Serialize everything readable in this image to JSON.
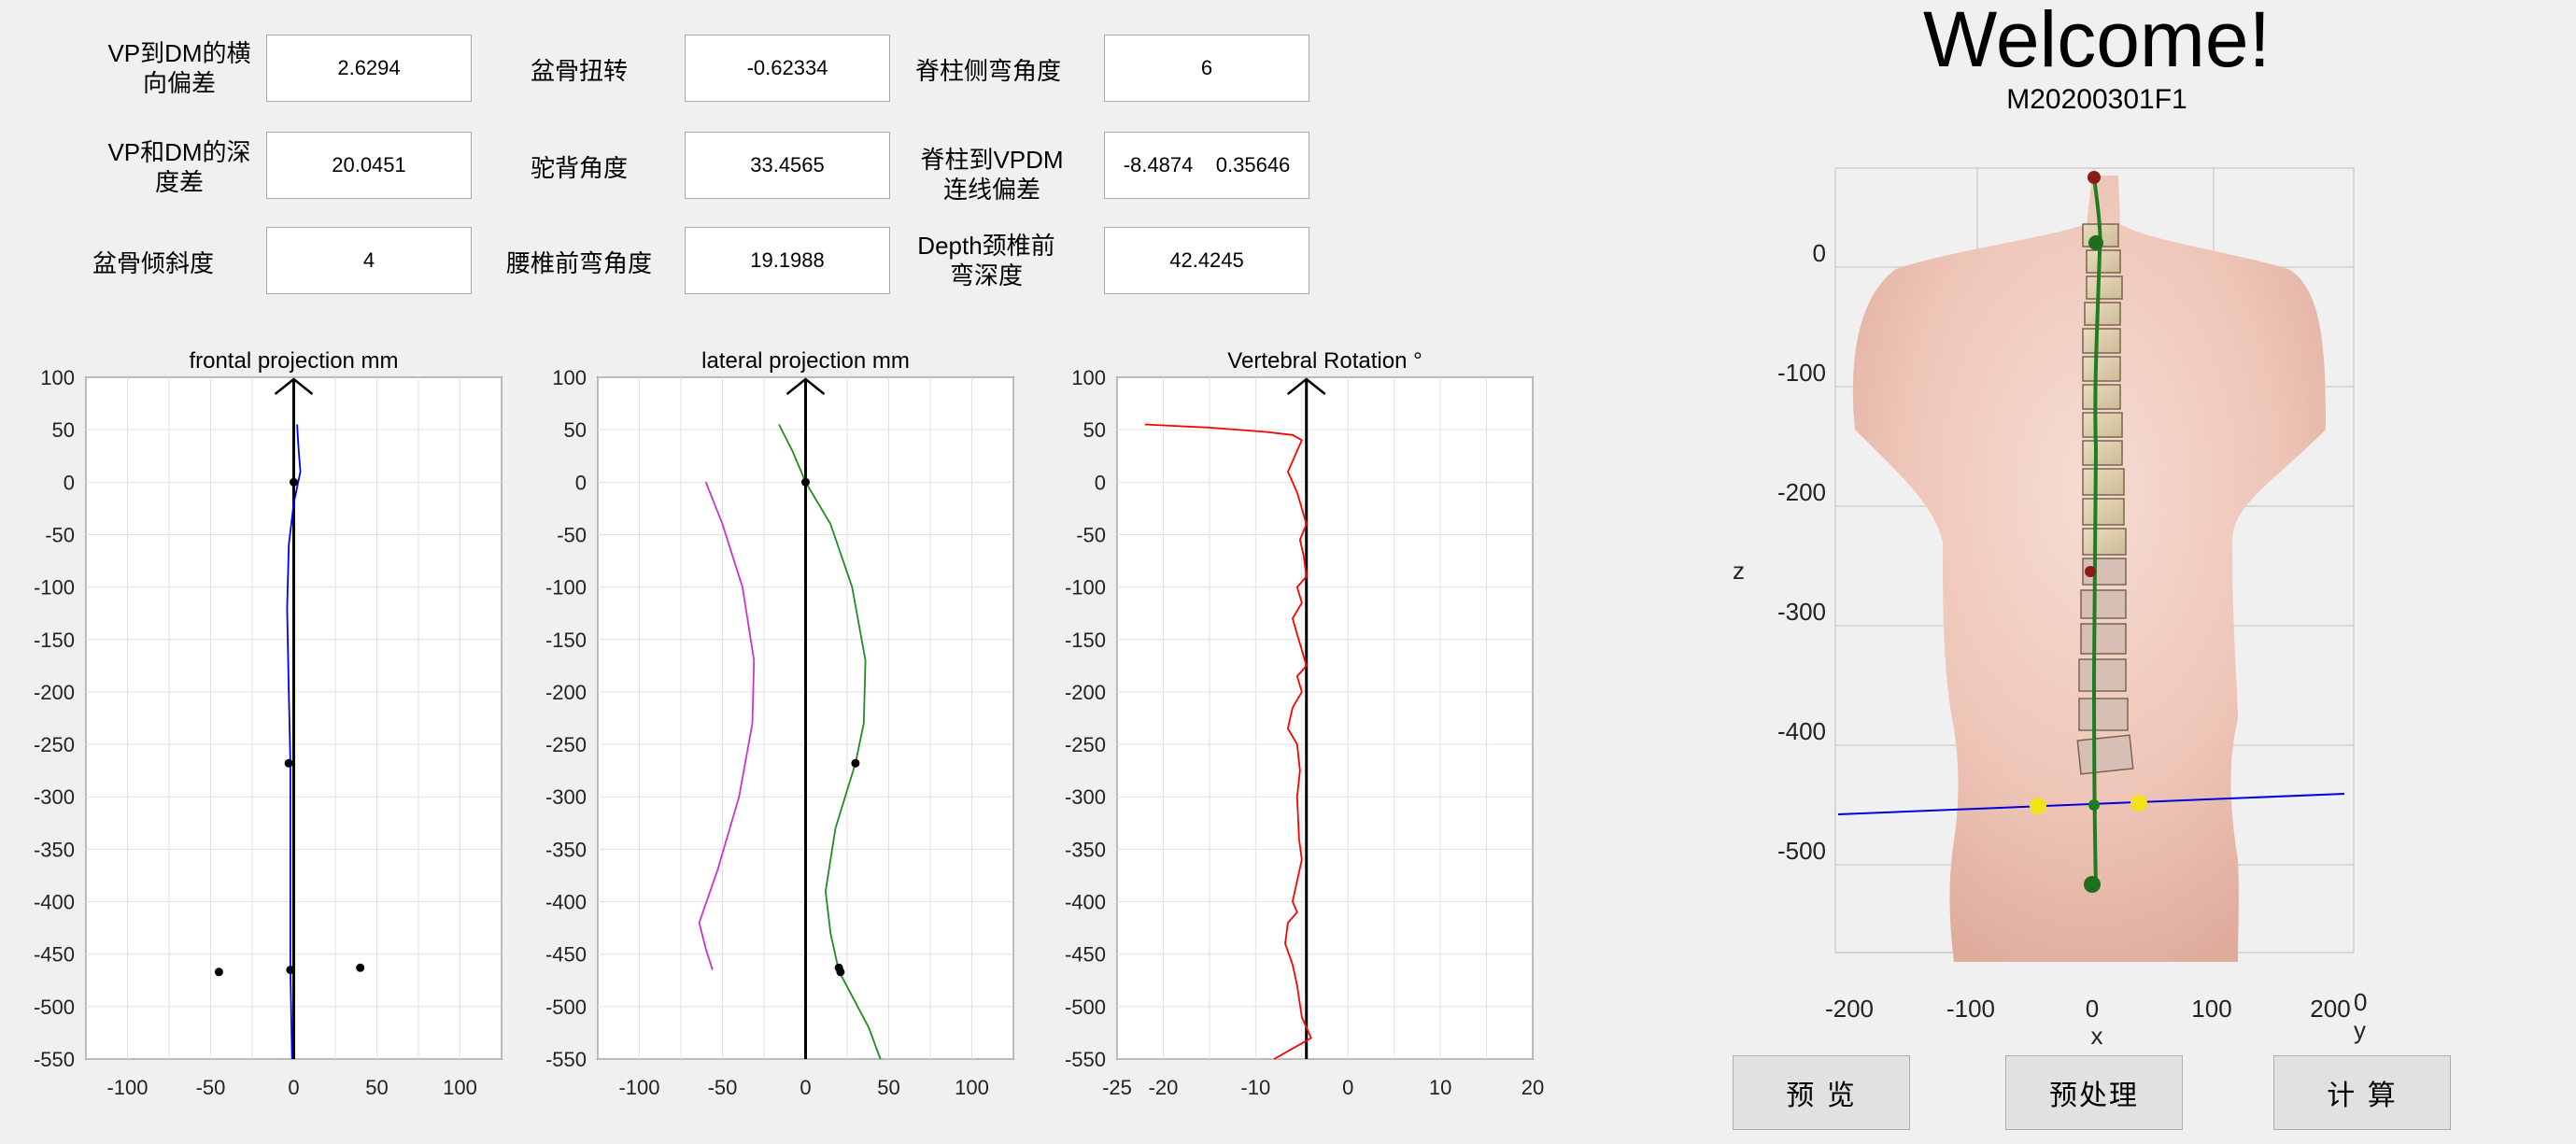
{
  "params": [
    {
      "label": "VP到DM的横\n向偏差",
      "value": "2.6294"
    },
    {
      "label": "盆骨扭转",
      "value": "-0.62334"
    },
    {
      "label": "脊柱侧弯角度",
      "value": "6"
    },
    {
      "label": "VP和DM的深\n度差",
      "value": "20.0451"
    },
    {
      "label": "驼背角度",
      "value": "33.4565"
    },
    {
      "label": "脊柱到VPDM\n连线偏差",
      "value": "-8.4874    0.35646"
    },
    {
      "label": "盆骨倾斜度",
      "value": "4"
    },
    {
      "label": "腰椎前弯角度",
      "value": "19.1988"
    },
    {
      "label": "Depth颈椎前\n弯深度",
      "value": "42.4245"
    }
  ],
  "chart_data": [
    {
      "type": "line",
      "title": "frontal projection mm",
      "xlim": [
        -125,
        125
      ],
      "ylim": [
        -550,
        100
      ],
      "xticks": [
        -100,
        -50,
        0,
        50,
        100
      ],
      "yticks": [
        100,
        50,
        0,
        -50,
        -100,
        -150,
        -200,
        -250,
        -300,
        -350,
        -400,
        -450,
        -500,
        -550
      ],
      "grid": true,
      "series": [
        {
          "color": "#0000ff",
          "points": [
            [
              2,
              55
            ],
            [
              3,
              30
            ],
            [
              4,
              10
            ],
            [
              0,
              -20
            ],
            [
              -3,
              -60
            ],
            [
              -4,
              -120
            ],
            [
              -3,
              -200
            ],
            [
              -2,
              -268
            ],
            [
              -2,
              -340
            ],
            [
              -2,
              -420
            ],
            [
              -2,
              -465
            ],
            [
              -1,
              -550
            ]
          ]
        }
      ],
      "axis_arrow_x": 0,
      "markers": [
        [
          0,
          0
        ],
        [
          -3,
          -268
        ],
        [
          -2,
          -465
        ],
        [
          -45,
          -467
        ],
        [
          40,
          -463
        ]
      ]
    },
    {
      "type": "line",
      "title": "lateral projection mm",
      "xlim": [
        -125,
        125
      ],
      "ylim": [
        -550,
        100
      ],
      "xticks": [
        -100,
        -50,
        0,
        50,
        100
      ],
      "yticks": [
        100,
        50,
        0,
        -50,
        -100,
        -150,
        -200,
        -250,
        -300,
        -350,
        -400,
        -450,
        -500,
        -550
      ],
      "grid": true,
      "series": [
        {
          "color": "#cc33cc",
          "points": [
            [
              -60,
              0
            ],
            [
              -50,
              -40
            ],
            [
              -38,
              -100
            ],
            [
              -31,
              -170
            ],
            [
              -32,
              -230
            ],
            [
              -40,
              -300
            ],
            [
              -53,
              -370
            ],
            [
              -64,
              -420
            ],
            [
              -60,
              -445
            ],
            [
              -56,
              -465
            ]
          ]
        },
        {
          "color": "#228b22",
          "points": [
            [
              -16,
              55
            ],
            [
              -8,
              30
            ],
            [
              0,
              0
            ],
            [
              15,
              -40
            ],
            [
              28,
              -100
            ],
            [
              36,
              -170
            ],
            [
              35,
              -230
            ],
            [
              30,
              -268
            ],
            [
              18,
              -330
            ],
            [
              12,
              -390
            ],
            [
              15,
              -430
            ],
            [
              20,
              -466
            ],
            [
              28,
              -490
            ],
            [
              38,
              -520
            ],
            [
              45,
              -550
            ]
          ]
        }
      ],
      "axis_arrow_x": 0,
      "markers": [
        [
          0,
          0
        ],
        [
          30,
          -268
        ],
        [
          20,
          -463
        ],
        [
          21,
          -467
        ]
      ]
    },
    {
      "type": "line",
      "title": "Vertebral Rotation °",
      "xlim": [
        -25,
        20
      ],
      "ylim": [
        -550,
        100
      ],
      "xticks": [
        -25,
        -20,
        -10,
        0,
        10,
        20
      ],
      "yticks": [
        100,
        50,
        0,
        -50,
        -100,
        -150,
        -200,
        -250,
        -300,
        -350,
        -400,
        -450,
        -500,
        -550
      ],
      "grid": true,
      "series": [
        {
          "color": "#ff0000",
          "points": [
            [
              -22,
              55
            ],
            [
              -15,
              52
            ],
            [
              -9,
              48
            ],
            [
              -6,
              45
            ],
            [
              -5,
              40
            ],
            [
              -5.5,
              30
            ],
            [
              -6,
              20
            ],
            [
              -6.5,
              10
            ],
            [
              -6,
              0
            ],
            [
              -5.5,
              -10
            ],
            [
              -5,
              -25
            ],
            [
              -4.5,
              -40
            ],
            [
              -5.2,
              -55
            ],
            [
              -4.8,
              -70
            ],
            [
              -4.5,
              -90
            ],
            [
              -5.5,
              -100
            ],
            [
              -5,
              -115
            ],
            [
              -6,
              -130
            ],
            [
              -5.5,
              -145
            ],
            [
              -5,
              -160
            ],
            [
              -4.5,
              -175
            ],
            [
              -5.5,
              -185
            ],
            [
              -5,
              -200
            ],
            [
              -6,
              -215
            ],
            [
              -6.5,
              -235
            ],
            [
              -5.5,
              -250
            ],
            [
              -5.2,
              -275
            ],
            [
              -5.5,
              -300
            ],
            [
              -5.3,
              -340
            ],
            [
              -5,
              -360
            ],
            [
              -5.5,
              -380
            ],
            [
              -6,
              -400
            ],
            [
              -5.5,
              -410
            ],
            [
              -6.5,
              -420
            ],
            [
              -6.8,
              -440
            ],
            [
              -6,
              -460
            ],
            [
              -5.5,
              -480
            ],
            [
              -5,
              -510
            ],
            [
              -4,
              -530
            ],
            [
              -5,
              -535
            ],
            [
              -8,
              -550
            ]
          ]
        }
      ],
      "axis_arrow_x": -4.5,
      "markers": []
    }
  ],
  "view3d": {
    "title": "Welcome!",
    "subtitle": "M20200301F1",
    "zlabel": "z",
    "xlabel": "x",
    "ylabel": "y",
    "zticks": [
      "0",
      "-100",
      "-200",
      "-300",
      "-400",
      "-500"
    ],
    "xticks": [
      "-200",
      "-100",
      "0",
      "100",
      "200"
    ],
    "ytick": "0"
  },
  "buttons": {
    "preview": "预 览",
    "preprocess": "预处理",
    "compute": "计 算"
  }
}
